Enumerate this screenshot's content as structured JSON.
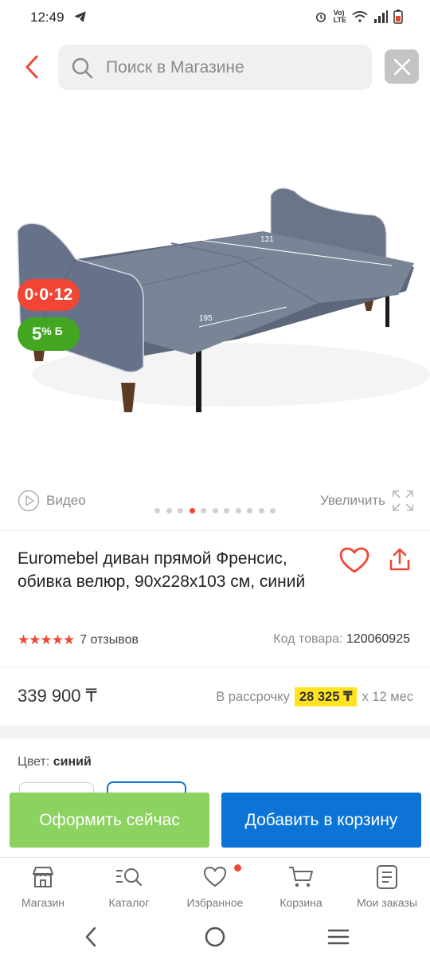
{
  "status_bar": {
    "time": "12:49"
  },
  "search": {
    "placeholder": "Поиск в Магазине"
  },
  "badges": {
    "installment": "0·0·12",
    "bonus_value": "5",
    "bonus_symbol": "% Б"
  },
  "media": {
    "video_label": "Видео",
    "zoom_label": "Увеличить",
    "slide_count": 11,
    "active_slide": 3
  },
  "product": {
    "title": "Euromebel диван прямой Френсис, обивка велюр, 90x228x103 см, синий",
    "stars": "★★★★★",
    "rating": 5,
    "reviews": "7 отзывов",
    "sku_label": "Код товара:",
    "sku": "120060925",
    "price": "339 900 ₸",
    "installment_prefix": "В рассрочку",
    "installment_amount": "28 325 ₸",
    "installment_suffix": "x 12 мес",
    "color_label": "Цвет:",
    "color_value": "синий",
    "dimension_labels": {
      "width": "131",
      "length": "195"
    }
  },
  "actions": {
    "buy_now": "Оформить сейчас",
    "add_to_cart": "Добавить в корзину"
  },
  "bottom_nav": [
    {
      "label": "Магазин",
      "icon": "shop-icon"
    },
    {
      "label": "Каталог",
      "icon": "catalog-search-icon"
    },
    {
      "label": "Избранное",
      "icon": "heart-icon"
    },
    {
      "label": "Корзина",
      "icon": "cart-icon"
    },
    {
      "label": "Мои заказы",
      "icon": "orders-icon"
    }
  ],
  "colors": {
    "accent_red": "#f14635",
    "green": "#8bd261",
    "blue": "#0b74d6",
    "yellow": "#ffe31f",
    "bonus_green": "#43a620"
  }
}
